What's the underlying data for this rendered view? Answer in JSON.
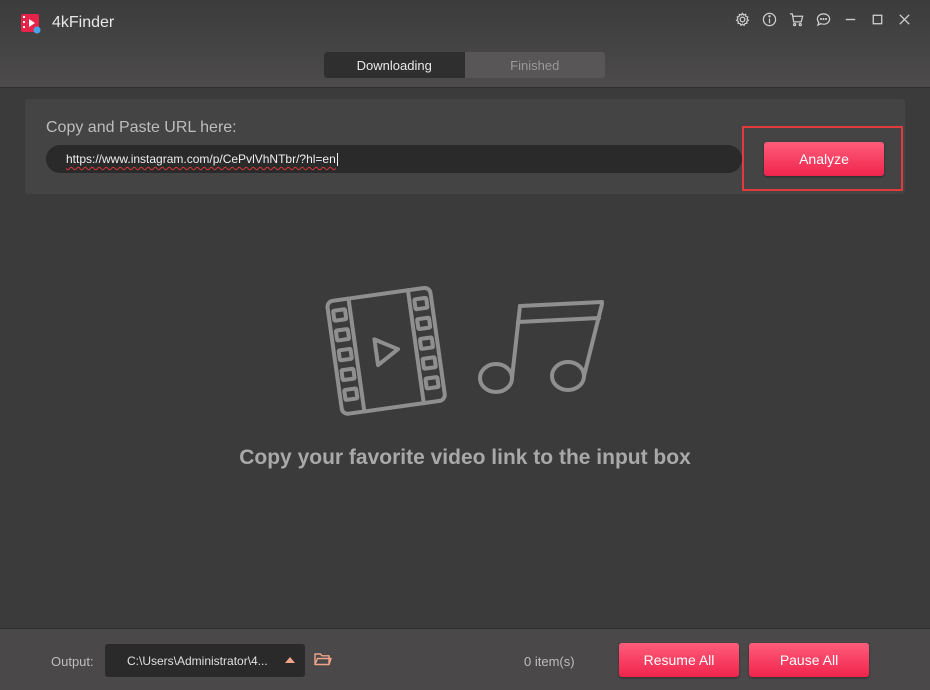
{
  "app": {
    "name": "4kFinder"
  },
  "window_controls": {
    "settings_icon": "gear-icon",
    "info_icon": "info-icon",
    "cart_icon": "cart-icon",
    "feedback_icon": "chat-icon",
    "minimize_icon": "minimize-icon",
    "maximize_icon": "maximize-icon",
    "close_icon": "close-icon"
  },
  "tabs": [
    {
      "label": "Downloading",
      "active": true
    },
    {
      "label": "Finished",
      "active": false
    }
  ],
  "url_panel": {
    "label": "Copy and Paste URL here:",
    "url_value": "https://www.instagram.com/p/CePvlVhNTbr/?hl=en",
    "analyze_label": "Analyze"
  },
  "empty_state": {
    "message": "Copy your favorite video link to the input box",
    "icons": [
      "video-film-icon",
      "music-note-icon"
    ]
  },
  "bottom_bar": {
    "output_label": "Output:",
    "output_path": "C:\\Users\\Administrator\\4...",
    "items_count": "0 item(s)",
    "resume_all_label": "Resume All",
    "pause_all_label": "Pause All"
  },
  "colors": {
    "accent": "#f0244d",
    "highlight_border": "#e23b3b",
    "background": "#3b3b3b"
  }
}
